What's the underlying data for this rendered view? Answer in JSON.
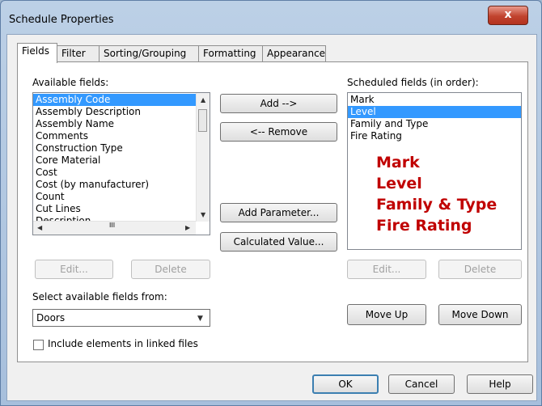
{
  "window": {
    "title": "Schedule Properties",
    "close_glyph": "x"
  },
  "tabs": [
    {
      "label": "Fields"
    },
    {
      "label": "Filter"
    },
    {
      "label": "Sorting/Grouping"
    },
    {
      "label": "Formatting"
    },
    {
      "label": "Appearance"
    }
  ],
  "available": {
    "label": "Available fields:",
    "items": [
      "Assembly Code",
      "Assembly Description",
      "Assembly Name",
      "Comments",
      "Construction Type",
      "Core Material",
      "Cost",
      "Cost (by manufacturer)",
      "Count",
      "Cut Lines",
      "Description"
    ],
    "selected_index": 0,
    "hscroll_glyph": "III"
  },
  "scheduled": {
    "label": "Scheduled fields (in order):",
    "items": [
      "Mark",
      "Level",
      "Family and Type",
      "Fire Rating"
    ],
    "selected_index": 1
  },
  "annotation": {
    "lines": [
      "Mark",
      "Level",
      "Family & Type",
      "Fire Rating"
    ],
    "color": "#c00000"
  },
  "buttons": {
    "add": "Add -->",
    "remove": "<-- Remove",
    "add_parameter": "Add Parameter...",
    "calculated_value": "Calculated Value...",
    "edit_left": "Edit...",
    "delete_left": "Delete",
    "edit_right": "Edit...",
    "delete_right": "Delete",
    "move_up": "Move Up",
    "move_down": "Move Down",
    "ok": "OK",
    "cancel": "Cancel",
    "help": "Help"
  },
  "select_from": {
    "label": "Select available fields from:",
    "value": "Doors"
  },
  "include_linked": {
    "label": "Include elements in linked files",
    "checked": false
  },
  "colors": {
    "selection": "#3399ff",
    "titlebar": "#bcd0e6",
    "close": "#c1432e"
  }
}
